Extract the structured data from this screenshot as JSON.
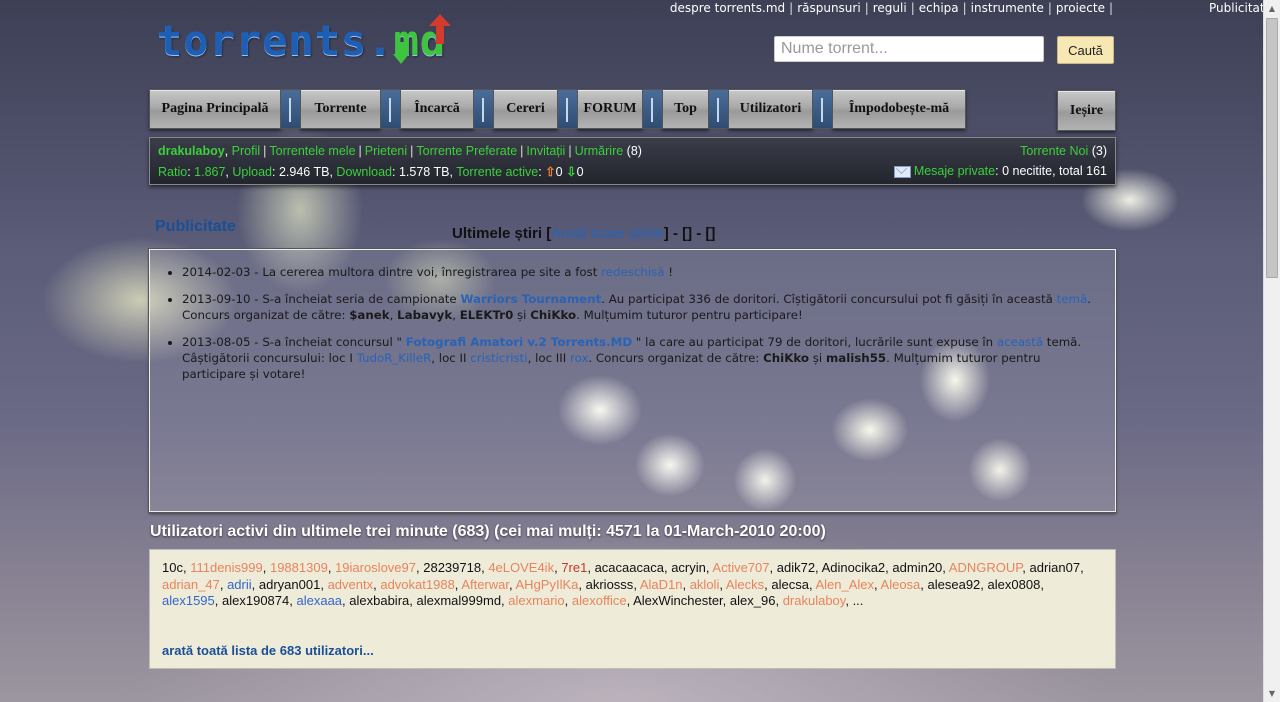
{
  "top_links": [
    "despre torrents.md",
    "răspunsuri",
    "reguli",
    "echipa",
    "instrumente",
    "proiecte"
  ],
  "top_publicitate": "Publicitate",
  "logo": {
    "main": "torrents.",
    "accent": "md"
  },
  "search": {
    "placeholder": "Nume torrent...",
    "button": "Caută"
  },
  "nav": [
    "Pagina Principală",
    "Torrente",
    "Încarcă",
    "Cereri",
    "FORUM",
    "Top",
    "Utilizatori",
    "Împodobește-mă"
  ],
  "logout": "Ieșire",
  "userpanel": {
    "username": "drakulaboy",
    "links": [
      "Profil",
      "Torrentele mele",
      "Prieteni",
      "Torrente Preferate",
      "Invitații",
      "Urmărire"
    ],
    "urmarire_count": "(8)",
    "ratio_label": "Ratio",
    "ratio_value": "1.867",
    "upload_label": "Upload",
    "upload_value": "2.946 TB",
    "download_label": "Download",
    "download_value": "1.578 TB",
    "active_label": "Torrente active",
    "active_up": "0",
    "active_down": "0",
    "new_torrents_label": "Torrente Noi",
    "new_torrents_count": "(3)",
    "pm_label": "Mesaje private",
    "pm_value": "0 necitite, total 161"
  },
  "publicitate_title": "Publicitate",
  "news": {
    "title": "Ultimele știri",
    "show_all": "Arată toate știrile",
    "tail": "- [] - []",
    "items": [
      {
        "date": "2014-02-03",
        "text": " - La cererea multora dintre voi, înregistrarea pe site a fost ",
        "link": "redeschisă",
        "after": " !"
      },
      {
        "date": "2013-09-10",
        "text": " - S-a încheiat seria de campionate ",
        "link": "Warriors Tournament",
        "after": ". Au participat 336 de doritori. Cîștigătorii concursului pot fi găsiți în această ",
        "link2": "temă",
        "after2": ". Concurs organizat de către: ",
        "org1": "$anek",
        "org2": "Labavyk",
        "org3": "ELEKTr0",
        "and": " și ",
        "org4": "ChiKko",
        "end": ". Mulțumim tuturor pentru participare!"
      },
      {
        "date": "2013-08-05",
        "text": " - S-a încheiat concursul \" ",
        "link": "Fotografi Amatori v.2 Torrents.MD",
        "after": " \" la care au participat 79 de doritori, lucrările sunt expuse în ",
        "link2": "această",
        "after2": " temă. Câștigătorii concursului: loc I ",
        "w1": "TudoR_KilleR",
        "loc2": ", loc II ",
        "w2": "cristicristi",
        "loc3": ", loc III ",
        "w3": "rox",
        "org_text": ". Concurs organizat de către: ",
        "org1": "ChiKko",
        "and": " și ",
        "org2": "malish55",
        "end": ". Mulțumim tuturor pentru participare și votare!"
      }
    ]
  },
  "online": {
    "title": "Utilizatori activi din ultimele trei minute (683) (cei mai mulți: 4571 la 01-March-2010 20:00)",
    "users": [
      {
        "n": "10c",
        "c": "dark"
      },
      {
        "n": "111denis999",
        "c": "orange"
      },
      {
        "n": "19881309",
        "c": "orange"
      },
      {
        "n": "19iaroslove97",
        "c": "orange"
      },
      {
        "n": "28239718",
        "c": "dark"
      },
      {
        "n": "4eLOVE4ik",
        "c": "orange"
      },
      {
        "n": "7re1",
        "c": "red"
      },
      {
        "n": "acacaacaca",
        "c": "dark"
      },
      {
        "n": "acryin",
        "c": "dark"
      },
      {
        "n": "Active707",
        "c": "orange"
      },
      {
        "n": "adik72",
        "c": "dark"
      },
      {
        "n": "Adinocika2",
        "c": "dark"
      },
      {
        "n": "admin20",
        "c": "dark"
      },
      {
        "n": "ADNGROUP",
        "c": "orange"
      },
      {
        "n": "adrian07",
        "c": "dark"
      },
      {
        "n": "adrian_47",
        "c": "orange"
      },
      {
        "n": "adrii",
        "c": "blue"
      },
      {
        "n": "adryan001",
        "c": "dark"
      },
      {
        "n": "adventx",
        "c": "orange"
      },
      {
        "n": "advokat1988",
        "c": "orange"
      },
      {
        "n": "Afterwar",
        "c": "orange"
      },
      {
        "n": "AHgPyIlKa",
        "c": "orange"
      },
      {
        "n": "akriosss",
        "c": "dark"
      },
      {
        "n": "AlaD1n",
        "c": "orange"
      },
      {
        "n": "akloli",
        "c": "orange"
      },
      {
        "n": "Alecks",
        "c": "orange"
      },
      {
        "n": "alecsa",
        "c": "dark"
      },
      {
        "n": "Alen_Alex",
        "c": "orange"
      },
      {
        "n": "Aleosa",
        "c": "orange"
      },
      {
        "n": "alesea92",
        "c": "dark"
      },
      {
        "n": "alex0808",
        "c": "dark"
      },
      {
        "n": "alex1595",
        "c": "blue"
      },
      {
        "n": "alex190874",
        "c": "dark"
      },
      {
        "n": "alexaaa",
        "c": "blue"
      },
      {
        "n": "alexbabira",
        "c": "dark"
      },
      {
        "n": "alexmal999md",
        "c": "dark"
      },
      {
        "n": "alexmario",
        "c": "orange"
      },
      {
        "n": "alexoffice",
        "c": "orange"
      },
      {
        "n": "AlexWinchester",
        "c": "dark"
      },
      {
        "n": "alex_96",
        "c": "dark"
      },
      {
        "n": "drakulaboy",
        "c": "orange"
      }
    ],
    "ellipsis": "...",
    "show_all": "arată toată lista de 683 utilizatori..."
  }
}
